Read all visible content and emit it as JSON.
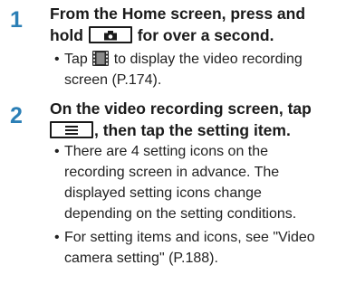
{
  "step1": {
    "number": "1",
    "heading_pre": "From the Home screen, press and",
    "heading_line2": "hold",
    "key_icon": "camera-icon",
    "heading_post": "for over a second.",
    "bullet": {
      "dot": "•",
      "text_pre": "Tap",
      "icon": "video-icon",
      "text_post": "to display the video recording",
      "line2": "screen (P.174)."
    }
  },
  "step2": {
    "number": "2",
    "heading_line1": "On the video recording screen, tap",
    "key_icon": "menu-icon",
    "heading_post": ", then tap the setting item.",
    "bullets": [
      {
        "dot": "•",
        "lines": [
          "There are 4 setting icons on the",
          "recording screen in advance. The",
          "displayed setting icons change",
          "depending on the setting conditions."
        ]
      },
      {
        "dot": "•",
        "lines": [
          "For setting items and icons, see \"Video",
          "camera setting\" (P.188)."
        ]
      }
    ]
  },
  "colors": {
    "step_number": "#2b7fb6",
    "text": "#1a1a1a"
  }
}
